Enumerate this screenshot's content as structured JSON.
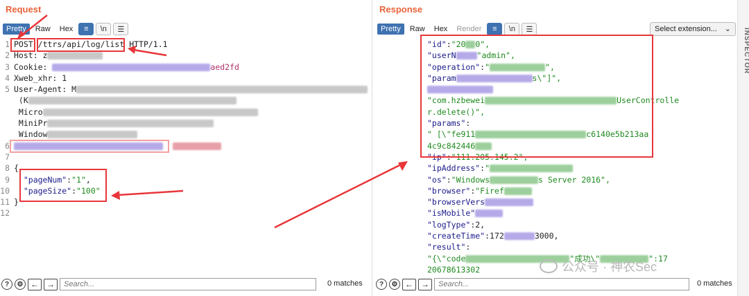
{
  "request": {
    "title": "Request",
    "tabs": [
      "Pretty",
      "Raw",
      "Hex"
    ],
    "lines": {
      "l1_method": "POST",
      "l1_path": "/ttrs/api/log/list",
      "l1_proto": " HTTP/1.1",
      "l2": "Host: z",
      "l3_label": "Cookie: ",
      "l3_tail": "aed2fd",
      "l4": "Xweb_xhr: 1",
      "l5": "User-Agent: M",
      "l5b": " (K",
      "l5c": " Micro",
      "l5d": " MiniPr",
      "l5e": " Window",
      "l8": "{",
      "l9_key": "\"pageNum\"",
      "l9_val": "\"1\"",
      "l10_key": "\"pageSize\"",
      "l10_val": "\"100\"",
      "l11": "}"
    },
    "search_placeholder": "Search...",
    "matches": "0 matches"
  },
  "response": {
    "title": "Response",
    "tabs": [
      "Pretty",
      "Raw",
      "Hex",
      "Render"
    ],
    "select_extension": "Select extension...",
    "lines": {
      "id_key": "\"id\"",
      "id_val": "\"20",
      "id_tail": "0\",",
      "user_key": "\"userN",
      "user_val": "\"admin\",",
      "op_key": "\"operation\"",
      "op_val": "\"",
      "op_tail": "\",",
      "param_key": "\"param",
      "param_tail": "s\\\"]\",",
      "method_a": "\"com.hzbewei",
      "method_b": "UserControlle",
      "method_c": "r.delete()\",",
      "params_key": "\"params\"",
      "params_a": "\" [\\\"fe911",
      "params_b": "c6140e5b213aa",
      "params_c": "4c9c842446",
      "ip_key": "\"ip\"",
      "ip_val": "\"111.205.145.2\",",
      "ipaddr_key": "\"ipAddress\"",
      "ipaddr_val": "\"",
      "os_key": "\"os\"",
      "os_val": "\"Windows",
      "os_tail": "s Server 2016\",",
      "browser_key": "\"browser\"",
      "browser_val": "\"Firef",
      "bver_key": "\"browserVers",
      "mobile_key": "\"isMobile\"",
      "logtype_key": "\"logType\"",
      "logtype_val": "2,",
      "ctime_key": "\"createTime\"",
      "ctime_val": "172",
      "ctime_tail": "3000,",
      "result_key": "\"result\"",
      "result_a": "\"{\\\"code",
      "result_b": "\"成功\\\"",
      "result_c": "\":17",
      "result_d": "20678613302"
    },
    "search_placeholder": "Search...",
    "matches": "0 matches"
  },
  "inspector_label": "INSPECTOR",
  "watermark": "公众号 · 神农Sec",
  "line_numbers": [
    "1",
    "2",
    "3",
    "4",
    "5",
    "",
    "",
    "",
    "",
    "6",
    "7",
    "8",
    "9",
    "10",
    "11",
    "12"
  ]
}
